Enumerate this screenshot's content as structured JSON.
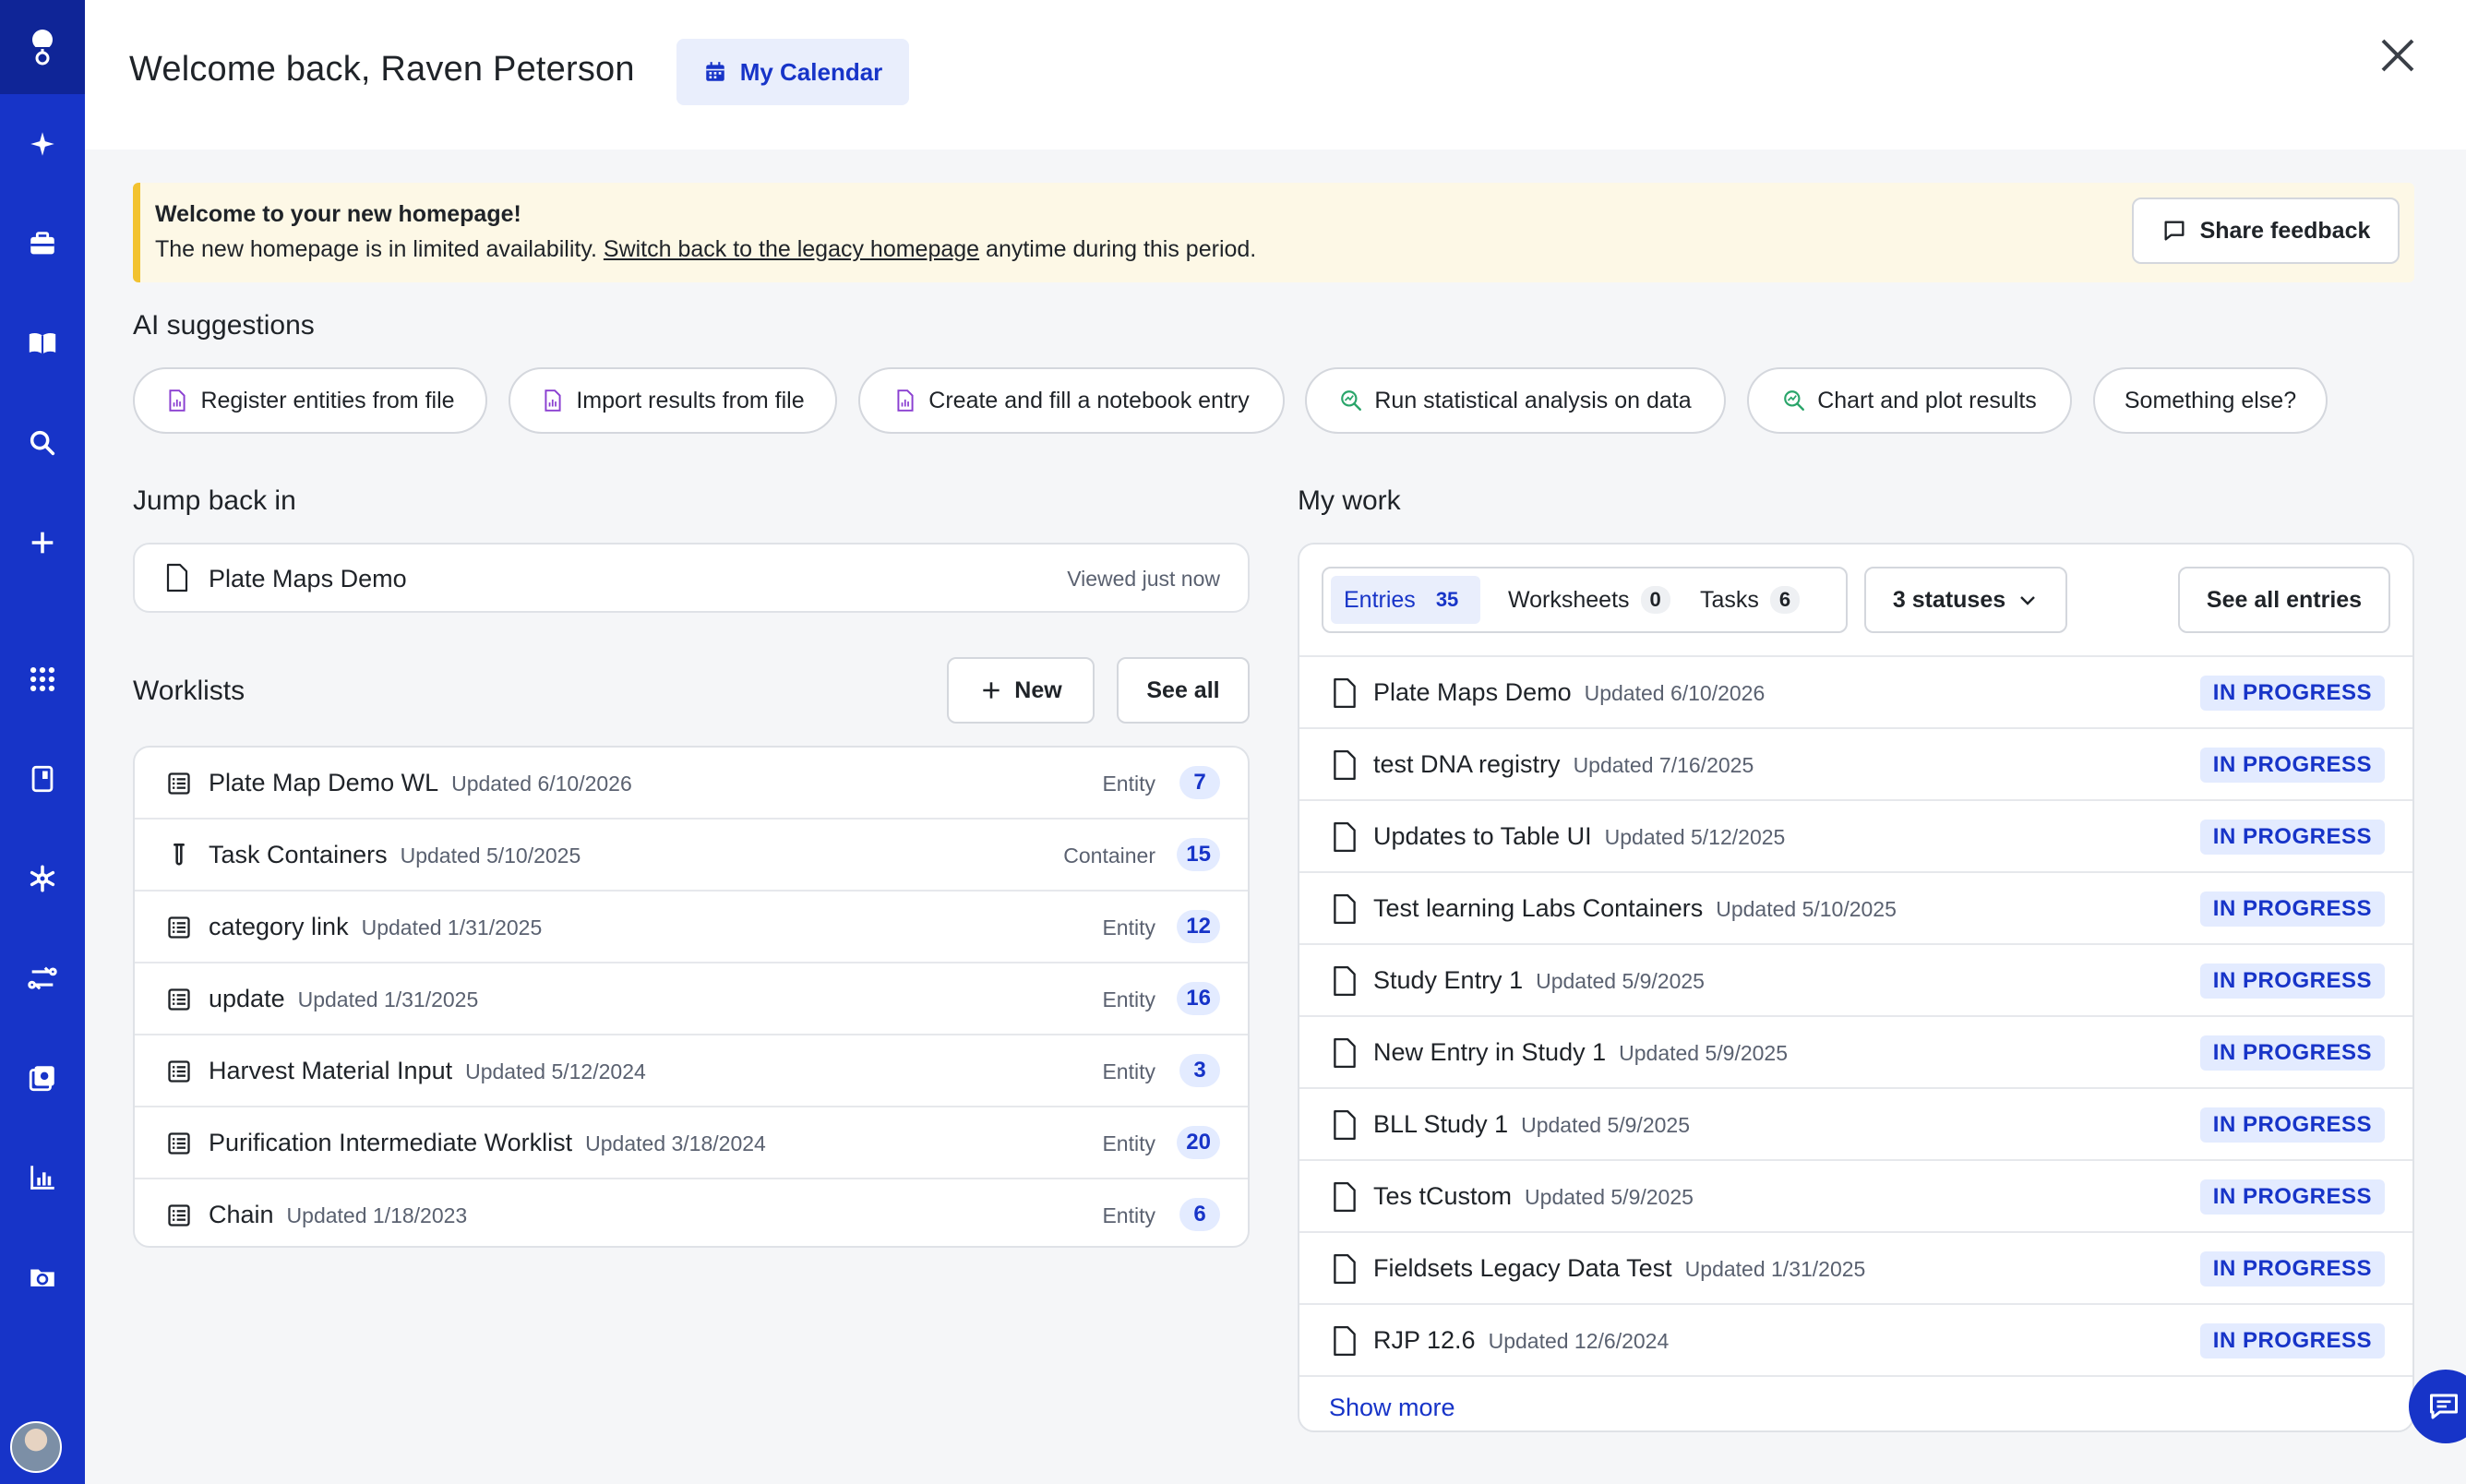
{
  "header": {
    "welcome": "Welcome back, Raven Peterson",
    "calendar_label": "My Calendar"
  },
  "banner": {
    "title": "Welcome to your new homepage!",
    "text_before": "The new homepage is in limited availability. ",
    "link": "Switch back to the legacy homepage",
    "text_after": " anytime during this period.",
    "feedback_label": "Share feedback"
  },
  "ai": {
    "title": "AI suggestions",
    "chips": [
      {
        "label": "Register entities from file",
        "icon": "file-chart-icon"
      },
      {
        "label": "Import results from file",
        "icon": "file-chart-icon"
      },
      {
        "label": "Create and fill a notebook entry",
        "icon": "file-chart-icon"
      },
      {
        "label": "Run statistical analysis on data",
        "icon": "search-chart-icon"
      },
      {
        "label": "Chart and plot results",
        "icon": "search-chart-icon"
      },
      {
        "label": "Something else?",
        "icon": ""
      }
    ]
  },
  "jump": {
    "title": "Jump back in",
    "item": {
      "name": "Plate Maps Demo",
      "meta": "Viewed just now"
    }
  },
  "worklists": {
    "title": "Worklists",
    "new_label": "New",
    "see_all_label": "See all",
    "rows": [
      {
        "name": "Plate Map Demo WL",
        "updated": "Updated 6/10/2026",
        "type": "Entity",
        "count": "7",
        "icon": "list-icon"
      },
      {
        "name": "Task Containers",
        "updated": "Updated 5/10/2025",
        "type": "Container",
        "count": "15",
        "icon": "tube-icon"
      },
      {
        "name": "category link",
        "updated": "Updated 1/31/2025",
        "type": "Entity",
        "count": "12",
        "icon": "list-icon"
      },
      {
        "name": "update",
        "updated": "Updated 1/31/2025",
        "type": "Entity",
        "count": "16",
        "icon": "list-icon"
      },
      {
        "name": "Harvest Material Input",
        "updated": "Updated 5/12/2024",
        "type": "Entity",
        "count": "3",
        "icon": "list-icon"
      },
      {
        "name": "Purification Intermediate Worklist",
        "updated": "Updated 3/18/2024",
        "type": "Entity",
        "count": "20",
        "icon": "list-icon"
      },
      {
        "name": "Chain",
        "updated": "Updated 1/18/2023",
        "type": "Entity",
        "count": "6",
        "icon": "list-icon"
      }
    ]
  },
  "mywork": {
    "title": "My work",
    "tabs": [
      {
        "label": "Entries",
        "count": "35"
      },
      {
        "label": "Worksheets",
        "count": "0"
      },
      {
        "label": "Tasks",
        "count": "6"
      }
    ],
    "status_filter": "3 statuses",
    "see_all_label": "See all entries",
    "rows": [
      {
        "name": "Plate Maps Demo",
        "updated": "Updated 6/10/2026",
        "status": "IN PROGRESS"
      },
      {
        "name": "test DNA registry",
        "updated": "Updated 7/16/2025",
        "status": "IN PROGRESS"
      },
      {
        "name": "Updates to Table UI",
        "updated": "Updated 5/12/2025",
        "status": "IN PROGRESS"
      },
      {
        "name": "Test learning Labs Containers",
        "updated": "Updated 5/10/2025",
        "status": "IN PROGRESS"
      },
      {
        "name": "Study Entry 1",
        "updated": "Updated 5/9/2025",
        "status": "IN PROGRESS"
      },
      {
        "name": "New Entry in Study 1",
        "updated": "Updated 5/9/2025",
        "status": "IN PROGRESS"
      },
      {
        "name": "BLL Study 1",
        "updated": "Updated 5/9/2025",
        "status": "IN PROGRESS"
      },
      {
        "name": "Tes tCustom",
        "updated": "Updated 5/9/2025",
        "status": "IN PROGRESS"
      },
      {
        "name": "Fieldsets Legacy Data Test",
        "updated": "Updated 1/31/2025",
        "status": "IN PROGRESS"
      },
      {
        "name": "RJP 12.6",
        "updated": "Updated 12/6/2024",
        "status": "IN PROGRESS"
      }
    ],
    "show_more": "Show more"
  },
  "colors": {
    "sidebar": "#1734c8",
    "accent": "#1734c8",
    "banner_bg": "#fdf8e6",
    "banner_border": "#f2c230",
    "badge_bg": "#e3ebff"
  },
  "sidebar_icons": [
    "logo-icon",
    "sparkle-icon",
    "briefcase-icon",
    "book-icon",
    "search-icon",
    "plus-icon",
    "apps-grid-icon",
    "notebook-icon",
    "molecule-icon",
    "workflow-icon",
    "registry-icon",
    "chart-icon",
    "sync-folder-icon"
  ]
}
